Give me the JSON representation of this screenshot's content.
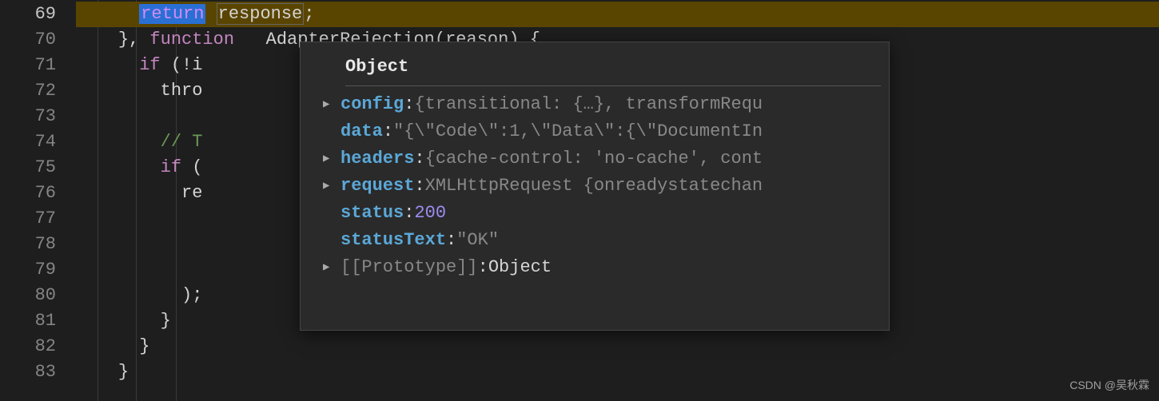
{
  "gutter": {
    "start": 69,
    "end": 83
  },
  "code": {
    "l69_return": "return",
    "l69_resp": "response",
    "l69_semi": ";",
    "l70_brace": "}, ",
    "l70_func": "function",
    "l70_rest": "   AdapterRejection(reason) {",
    "l71_if": "if",
    "l71_rest": " (!i",
    "l72": "thro",
    "l74": "// T",
    "l75_if": "if",
    "l75_rest": " (",
    "l76": "re",
    "l80": ");",
    "l81": "}",
    "l82": "}",
    "l83": "}"
  },
  "tooltip": {
    "title": "Object",
    "props": [
      {
        "arrow": true,
        "key": "config",
        "valType": "obj",
        "val": "{transitional: {…}, transformRequ"
      },
      {
        "arrow": false,
        "key": "data",
        "valType": "str",
        "val": "\"{\\\"Code\\\":1,\\\"Data\\\":{\\\"DocumentIn"
      },
      {
        "arrow": true,
        "key": "headers",
        "valType": "obj",
        "val": "{cache-control: 'no-cache', cont"
      },
      {
        "arrow": true,
        "key": "request",
        "valType": "obj",
        "val": "XMLHttpRequest {onreadystatechan"
      },
      {
        "arrow": false,
        "key": "status",
        "valType": "num",
        "val": "200"
      },
      {
        "arrow": false,
        "key": "statusText",
        "valType": "str",
        "val": "\"OK\""
      }
    ],
    "proto_key": "[[Prototype]]",
    "proto_val": "Object"
  },
  "watermark": "CSDN @吴秋霖"
}
